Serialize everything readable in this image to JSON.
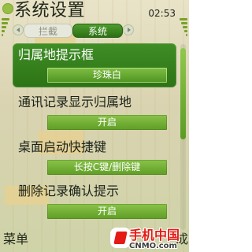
{
  "header": {
    "title": "系统设置",
    "clock": "02:53",
    "icons": [
      "app-icon",
      "signal-icon",
      "battery-icon"
    ]
  },
  "tabs": {
    "items": [
      {
        "label": "拦截",
        "active": false
      },
      {
        "label": "系统",
        "active": true
      }
    ],
    "arrow_icons": [
      "chevron-left-icon",
      "chevron-right-icon"
    ]
  },
  "settings": [
    {
      "label": "归属地提示框",
      "value": "珍珠白",
      "selected": true
    },
    {
      "label": "通讯记录显示归属地",
      "value": "开启",
      "selected": false
    },
    {
      "label": "桌面启动快捷键",
      "value": "长按C键/删除键",
      "selected": false
    },
    {
      "label": "删除记录确认提示",
      "value": "开启",
      "selected": false
    }
  ],
  "scroll": {
    "position_fraction": 0.0,
    "visible_fraction": 0.5
  },
  "softkeys": {
    "left": "菜单",
    "right": "成"
  },
  "watermark": {
    "brand": "手机中国",
    "domain": "CNMO.com"
  },
  "colors": {
    "accent_green": "#2d7315",
    "accent_light_green": "#8bc34a",
    "watermark_red": "#e41b14",
    "text_dark": "#1a2118"
  }
}
